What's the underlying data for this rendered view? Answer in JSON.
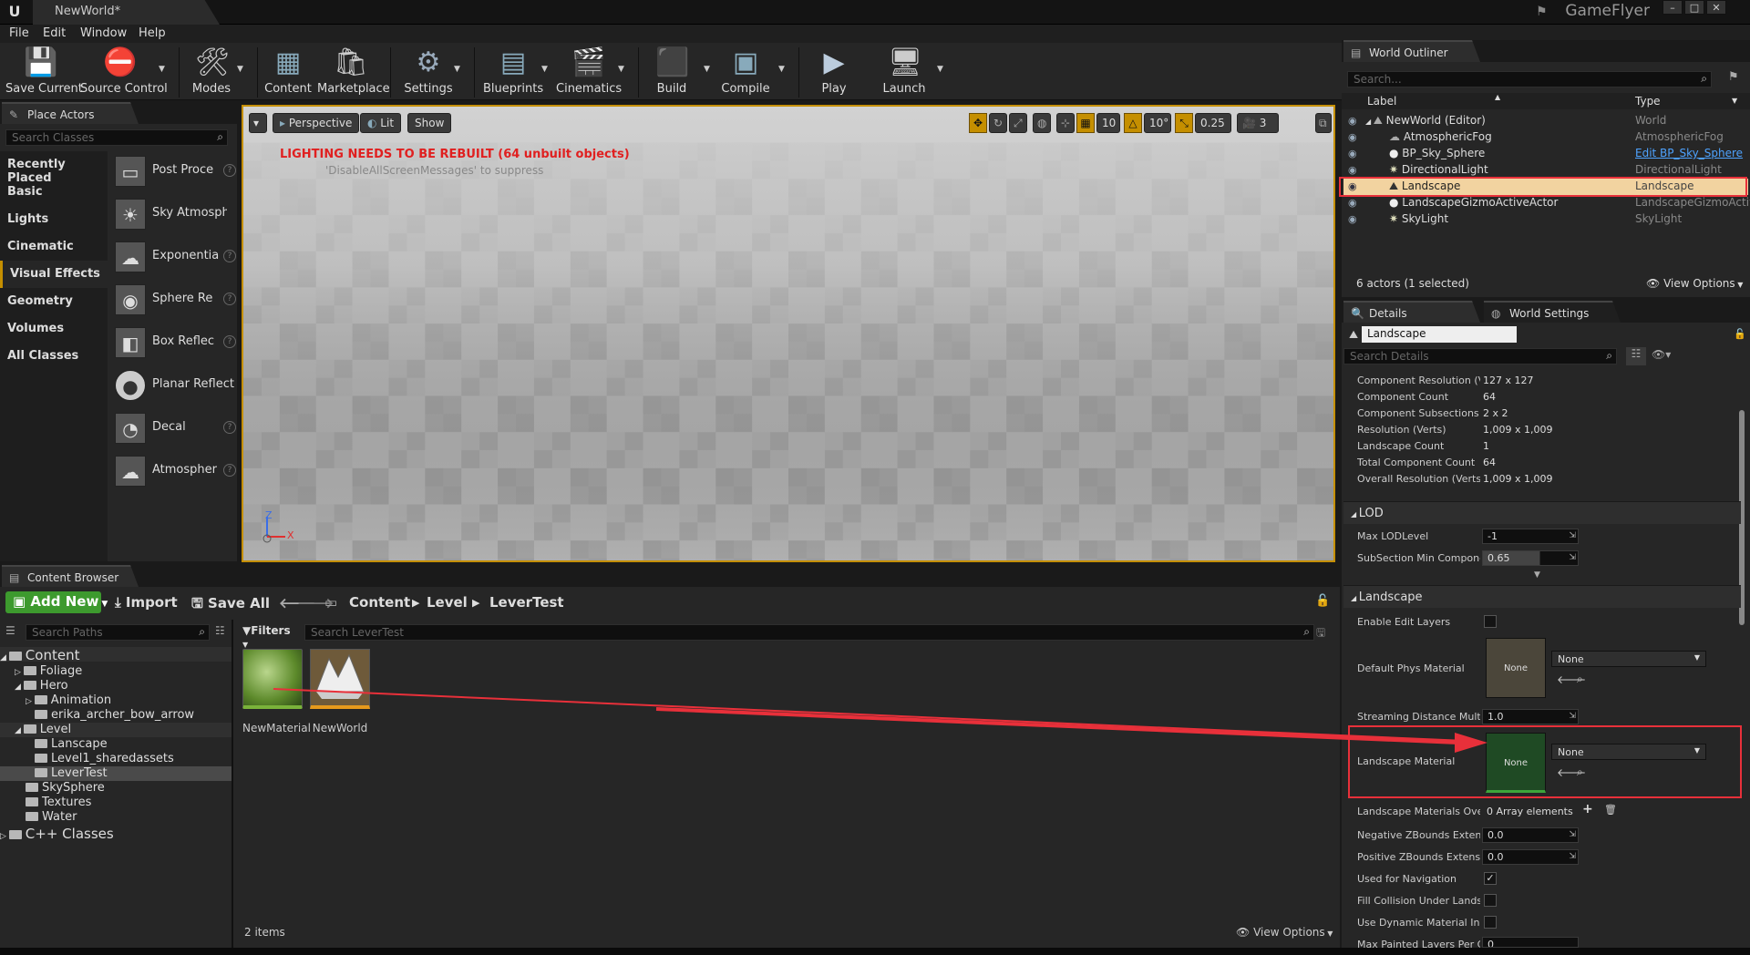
{
  "window": {
    "doc_tab": "NewWorld*",
    "project": "GameFlyer"
  },
  "menu": [
    "File",
    "Edit",
    "Window",
    "Help"
  ],
  "toolbar": {
    "buttons": [
      "Save Current",
      "Source Control",
      "Modes",
      "Content",
      "Marketplace",
      "Settings",
      "Blueprints",
      "Cinematics",
      "Build",
      "Compile",
      "Play",
      "Launch"
    ]
  },
  "place_actors": {
    "tab": "Place Actors",
    "search_placeholder": "Search Classes",
    "categories": [
      "Recently Placed",
      "Basic",
      "Lights",
      "Cinematic",
      "Visual Effects",
      "Geometry",
      "Volumes",
      "All Classes"
    ],
    "selected_category": "Visual Effects",
    "actors": [
      "Post Proce",
      "Sky Atmosphe",
      "Exponentia",
      "Sphere Re",
      "Box Reflec",
      "Planar Reflect",
      "Decal",
      "Atmospher"
    ]
  },
  "viewport": {
    "perspective": "Perspective",
    "lit": "Lit",
    "show": "Show",
    "grid_snap": "10",
    "rot_snap": "10°",
    "scale_snap": "0.25",
    "cam_speed": "3",
    "warning": "LIGHTING NEEDS TO BE REBUILT (64 unbuilt objects)",
    "hint": "'DisableAllScreenMessages' to suppress",
    "axis_z": "Z",
    "axis_x": "X"
  },
  "content_browser": {
    "tab": "Content Browser",
    "add_new": "Add New",
    "import": "Import",
    "save_all": "Save All",
    "breadcrumb": [
      "Content",
      "Level",
      "LeverTest"
    ],
    "path_search": "Search Paths",
    "filters": "Filters",
    "asset_search": "Search LeverTest",
    "tree": [
      {
        "label": "Content",
        "depth": 0
      },
      {
        "label": "Foliage",
        "depth": 1
      },
      {
        "label": "Hero",
        "depth": 1
      },
      {
        "label": "Animation",
        "depth": 2
      },
      {
        "label": "erika_archer_bow_arrow",
        "depth": 2
      },
      {
        "label": "Level",
        "depth": 1
      },
      {
        "label": "Lanscape",
        "depth": 2
      },
      {
        "label": "Level1_sharedassets",
        "depth": 2
      },
      {
        "label": "LeverTest",
        "depth": 2
      },
      {
        "label": "SkySphere",
        "depth": 1
      },
      {
        "label": "Textures",
        "depth": 1
      },
      {
        "label": "Water",
        "depth": 1
      },
      {
        "label": "C++ Classes",
        "depth": 0
      }
    ],
    "assets": [
      "NewMaterial",
      "NewWorld"
    ],
    "item_count": "2 items",
    "view_options": "View Options"
  },
  "outliner": {
    "tab": "World Outliner",
    "search_placeholder": "Search...",
    "col_label": "Label",
    "col_type": "Type",
    "rows": [
      {
        "label": "NewWorld (Editor)",
        "type": "World"
      },
      {
        "label": "AtmosphericFog",
        "type": "AtmosphericFog"
      },
      {
        "label": "BP_Sky_Sphere",
        "type": "Edit BP_Sky_Sphere"
      },
      {
        "label": "DirectionalLight",
        "type": "DirectionalLight"
      },
      {
        "label": "Landscape",
        "type": "Landscape"
      },
      {
        "label": "LandscapeGizmoActiveActor",
        "type": "LandscapeGizmoActiv"
      },
      {
        "label": "SkyLight",
        "type": "SkyLight"
      }
    ],
    "status": "6 actors (1 selected)",
    "view_options": "View Options"
  },
  "details": {
    "tab_details": "Details",
    "tab_world": "World Settings",
    "object_name": "Landscape",
    "search_placeholder": "Search Details",
    "info": [
      {
        "k": "Component Resolution (Ve",
        "v": "127 x 127"
      },
      {
        "k": "Component Count",
        "v": "64"
      },
      {
        "k": "Component Subsections",
        "v": "2 x 2"
      },
      {
        "k": "Resolution (Verts)",
        "v": "1,009 x 1,009"
      },
      {
        "k": "Landscape Count",
        "v": "1"
      },
      {
        "k": "Total Component Count",
        "v": "64"
      },
      {
        "k": "Overall Resolution (Verts)",
        "v": "1,009 x 1,009"
      }
    ],
    "lod_section": "LOD",
    "max_lod_label": "Max LODLevel",
    "max_lod": "-1",
    "subsection_label": "SubSection Min Componen",
    "subsection": "0.65",
    "landscape_section": "Landscape",
    "enable_edit_layers": "Enable Edit Layers",
    "phys_mat_label": "Default Phys Material",
    "none": "None",
    "stream_label": "Streaming Distance Multip",
    "stream": "1.0",
    "mat_label": "Landscape Material",
    "overrides_label": "Landscape Materials Overr",
    "overrides": "0 Array elements",
    "neg_z_label": "Negative ZBounds Extensi",
    "neg_z": "0.0",
    "pos_z_label": "Positive ZBounds Extensio",
    "pos_z": "0.0",
    "nav_label": "Used for Navigation",
    "fill_label": "Fill Collision Under Landsca",
    "dyn_label": "Use Dynamic Material Inst",
    "max_paint_label": "Max Painted Layers Per Cc",
    "max_paint": "0"
  },
  "colors": {
    "accent": "#c58f00",
    "selection": "#f2d3a0",
    "annotation": "#e8303a",
    "add_new": "#3d9a2e"
  }
}
